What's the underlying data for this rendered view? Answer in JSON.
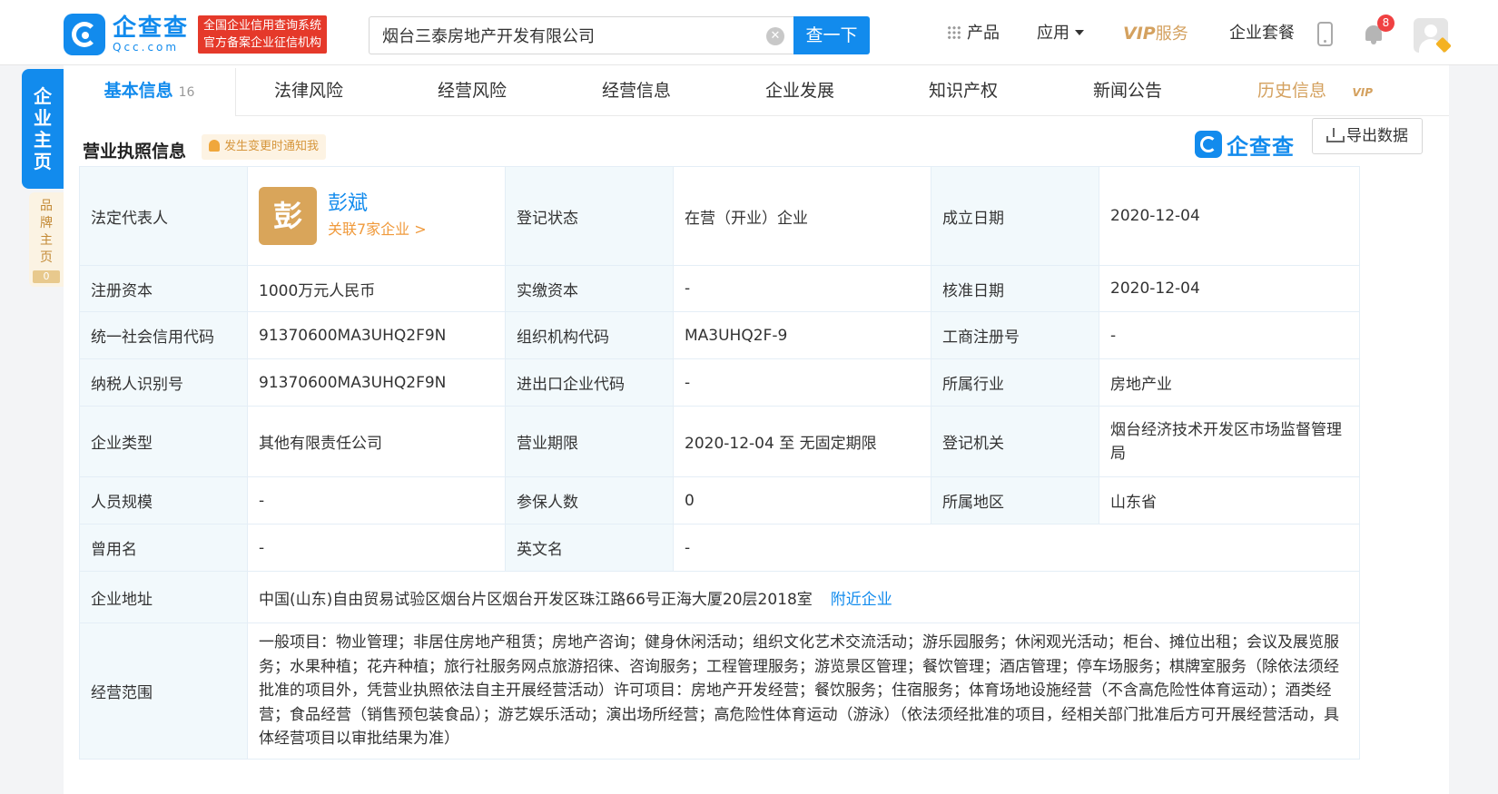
{
  "header": {
    "logo_cn": "企查查",
    "logo_en": "Qcc.com",
    "slogan_line1": "全国企业信用查询系统",
    "slogan_line2": "官方备案企业征信机构",
    "search_value": "烟台三泰房地产开发有限公司",
    "search_button": "查一下",
    "nav": {
      "products": "产品",
      "apps": "应用",
      "vip_prefix": "VIP",
      "vip_suffix": "服务",
      "enterprise": "企业套餐"
    },
    "notification_count": "8"
  },
  "side": {
    "main_tab": [
      "企",
      "业",
      "主",
      "页"
    ],
    "brand_tab": [
      "品",
      "牌",
      "主",
      "页"
    ],
    "brand_count": "0"
  },
  "tabs": [
    {
      "label": "基本信息",
      "count": "16"
    },
    {
      "label": "法律风险"
    },
    {
      "label": "经营风险"
    },
    {
      "label": "经营信息"
    },
    {
      "label": "企业发展"
    },
    {
      "label": "知识产权"
    },
    {
      "label": "新闻公告"
    },
    {
      "label": "历史信息",
      "badge": "VIP"
    }
  ],
  "section": {
    "title": "营业执照信息",
    "notify": "发生变更时通知我",
    "brand": "企查查",
    "export": "导出数据"
  },
  "info": {
    "legal_rep_label": "法定代表人",
    "legal_rep_avatar": "彭",
    "legal_rep_name": "彭斌",
    "legal_rep_related": "关联7家企业 >",
    "status_label": "登记状态",
    "status": "在营（开业）企业",
    "founded_label": "成立日期",
    "founded": "2020-12-04",
    "reg_capital_label": "注册资本",
    "reg_capital": "1000万元人民币",
    "paid_capital_label": "实缴资本",
    "paid_capital": "-",
    "approval_date_label": "核准日期",
    "approval_date": "2020-12-04",
    "credit_code_label": "统一社会信用代码",
    "credit_code": "91370600MA3UHQ2F9N",
    "org_code_label": "组织机构代码",
    "org_code": "MA3UHQ2F-9",
    "biz_reg_no_label": "工商注册号",
    "biz_reg_no": "-",
    "taxpayer_id_label": "纳税人识别号",
    "taxpayer_id": "91370600MA3UHQ2F9N",
    "import_export_label": "进出口企业代码",
    "import_export": "-",
    "industry_label": "所属行业",
    "industry": "房地产业",
    "company_type_label": "企业类型",
    "company_type": "其他有限责任公司",
    "term_label": "营业期限",
    "term": "2020-12-04 至 无固定期限",
    "reg_authority_label": "登记机关",
    "reg_authority": "烟台经济技术开发区市场监督管理局",
    "staff_size_label": "人员规模",
    "staff_size": "-",
    "insured_label": "参保人数",
    "insured": "0",
    "region_label": "所属地区",
    "region": "山东省",
    "former_name_label": "曾用名",
    "former_name": "-",
    "english_name_label": "英文名",
    "english_name": "-",
    "address_label": "企业地址",
    "address": "中国(山东)自由贸易试验区烟台片区烟台开发区珠江路66号正海大厦20层2018室",
    "nearby_link": "附近企业",
    "scope_label": "经营范围",
    "scope": "一般项目：物业管理；非居住房地产租赁；房地产咨询；健身休闲活动；组织文化艺术交流活动；游乐园服务；休闲观光活动；柜台、摊位出租；会议及展览服务；水果种植；花卉种植；旅行社服务网点旅游招徕、咨询服务；工程管理服务；游览景区管理；餐饮管理；酒店管理；停车场服务；棋牌室服务（除依法须经批准的项目外，凭营业执照依法自主开展经营活动）许可项目：房地产开发经营；餐饮服务；住宿服务；体育场地设施经营（不含高危险性体育运动）；酒类经营；食品经营（销售预包装食品）；游艺娱乐活动；演出场所经营；高危险性体育运动（游泳）（依法须经批准的项目，经相关部门批准后方可开展经营活动，具体经营项目以审批结果为准）"
  }
}
